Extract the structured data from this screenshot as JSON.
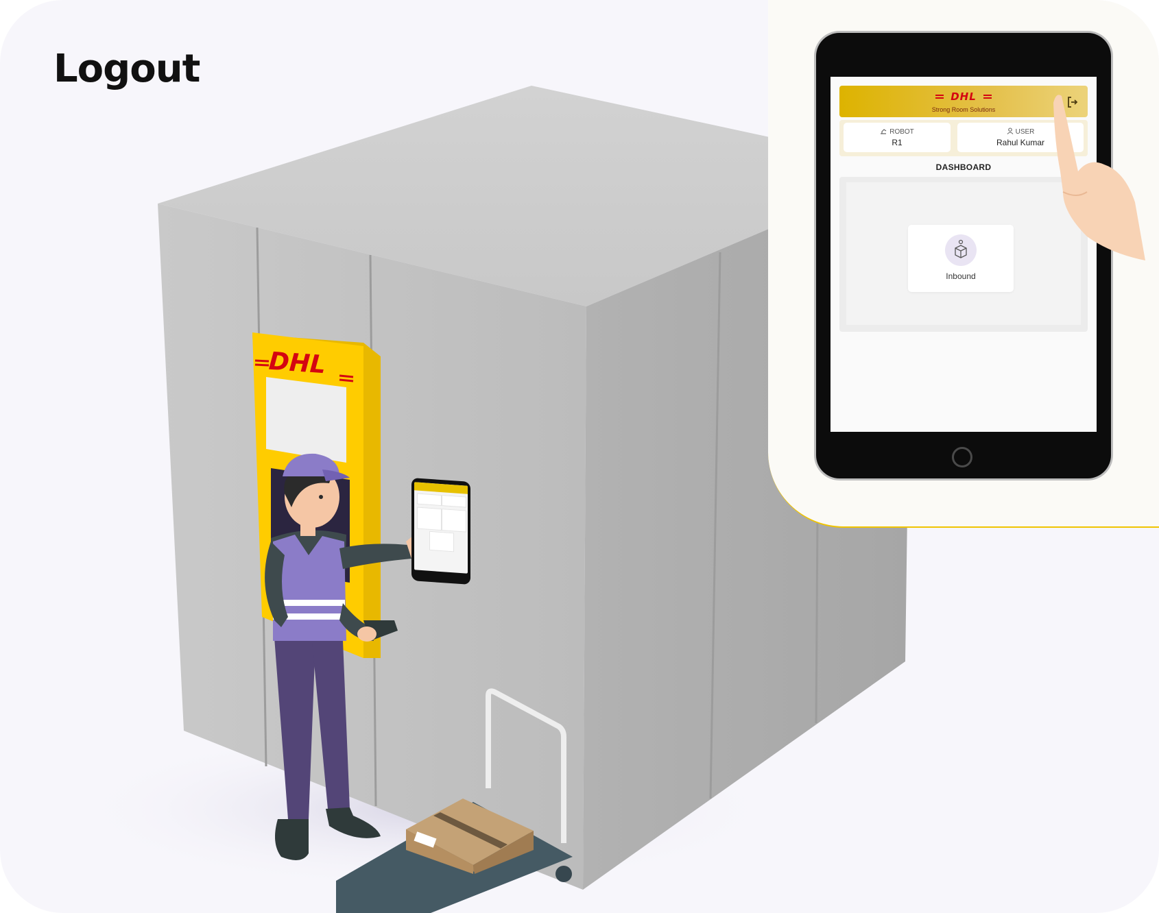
{
  "page": {
    "title": "Logout"
  },
  "scene": {
    "kiosk_logo": "DHL"
  },
  "app": {
    "brand": "DHL",
    "brand_subtitle": "Strong Room Solutions",
    "robot_label": "ROBOT",
    "robot_value": "R1",
    "user_label": "USER",
    "user_value": "Rahul Kumar",
    "dashboard_title": "DASHBOARD",
    "tiles": [
      {
        "label": "Inbound",
        "icon": "box-icon"
      }
    ],
    "logout_icon": "logout-icon"
  },
  "colors": {
    "brand_yellow": "#FFCC00",
    "brand_red": "#D40511",
    "header_gradient_start": "#DDB300",
    "header_gradient_end": "#ECD37A",
    "worker_vest": "#8B7CC8",
    "cabinet_gray": "#BDBDBD"
  }
}
